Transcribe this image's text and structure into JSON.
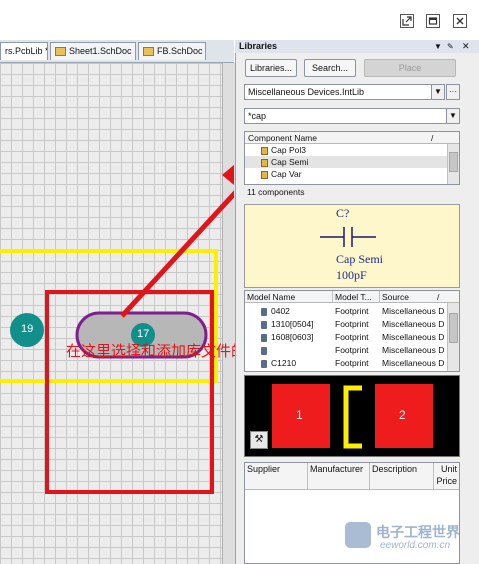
{
  "window": {
    "controls": [
      "popout-icon",
      "restore-icon",
      "close-icon"
    ]
  },
  "tabs": [
    {
      "label": "rs.PcbLib *"
    },
    {
      "label": "Sheet1.SchDoc"
    },
    {
      "label": "FB.SchDoc"
    }
  ],
  "canvas": {
    "pad_left_label": "19",
    "pad_selected_label": "17",
    "annotation": "在这里选择和添加库文件的啊"
  },
  "libraries": {
    "title": "Libraries",
    "buttons": {
      "libraries": "Libraries...",
      "search": "Search...",
      "place": "Place"
    },
    "library_select": "Miscellaneous Devices.IntLib",
    "filter_value": "*cap",
    "component_header": "Component Name",
    "components": [
      {
        "name": "Cap Pol3"
      },
      {
        "name": "Cap Semi"
      },
      {
        "name": "Cap Var"
      }
    ],
    "component_count": "11 components",
    "preview": {
      "designator": "C?",
      "comment": "Cap Semi",
      "value": "100pF"
    },
    "model_headers": [
      "Model Name",
      "Model T...",
      "Source"
    ],
    "models": [
      {
        "name": "0402",
        "type": "Footprint",
        "source": "Miscellaneous D"
      },
      {
        "name": "1310[0504]",
        "type": "Footprint",
        "source": "Miscellaneous D"
      },
      {
        "name": "1608[0603]",
        "type": "Footprint",
        "source": "Miscellaneous D"
      },
      {
        "name": "",
        "type": "Footprint",
        "source": "Miscellaneous D"
      },
      {
        "name": "C1210",
        "type": "Footprint",
        "source": "Miscellaneous D"
      }
    ],
    "footprint_pads": [
      "1",
      "2"
    ],
    "supplier_headers": [
      "Supplier",
      "Manufacturer",
      "Description",
      "Unit",
      "Price"
    ]
  },
  "watermark": {
    "text": "电子工程世界",
    "sub": "eeworld.com.cn"
  },
  "colors": {
    "annotation_red": "#e0151b",
    "pcb_yellow": "#ffee00",
    "pad_teal": "#118f8a",
    "pad_purple": "#7d1f8c",
    "footprint_pad_red": "#ee1c1c"
  }
}
